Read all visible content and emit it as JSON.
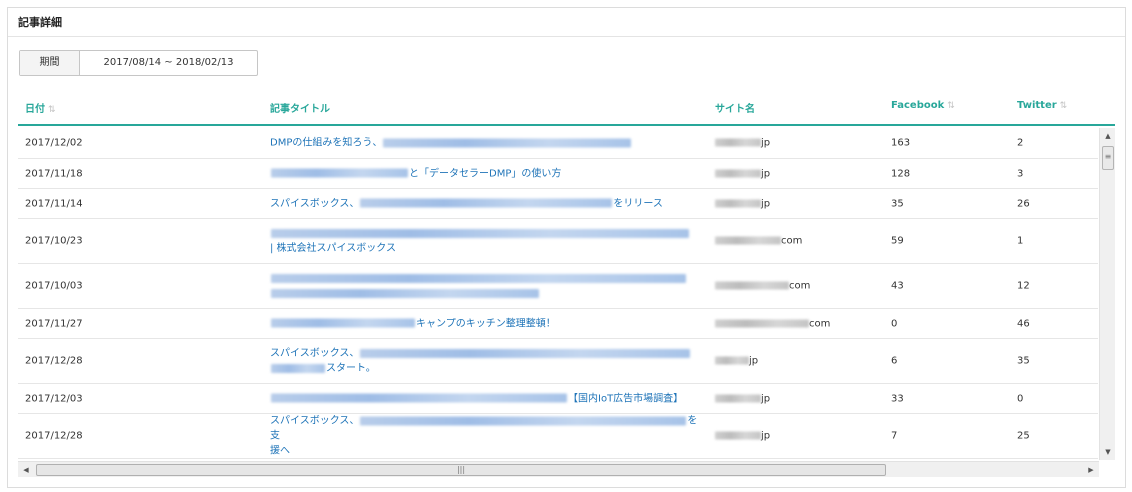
{
  "panel": {
    "title": "記事詳細"
  },
  "period": {
    "label": "期間",
    "value": "2017/08/14 ~ 2018/02/13"
  },
  "columns": {
    "date": "日付",
    "title": "記事タイトル",
    "site": "サイト名",
    "facebook": "Facebook",
    "twitter": "Twitter"
  },
  "rows": [
    {
      "date": "2017/12/02",
      "title_pre": "DMPの仕組みを知ろう、",
      "title_post": "",
      "title_line2": "",
      "site": "jp",
      "facebook": "163",
      "twitter": "2"
    },
    {
      "date": "2017/11/18",
      "title_pre": "",
      "title_post": "と「データセラーDMP」の使い方",
      "title_line2": "",
      "site": "jp",
      "facebook": "128",
      "twitter": "3"
    },
    {
      "date": "2017/11/14",
      "title_pre": "スパイスボックス、",
      "title_post": "をリリース",
      "title_line2": "",
      "site": "jp",
      "facebook": "35",
      "twitter": "26"
    },
    {
      "date": "2017/10/23",
      "title_pre": "",
      "title_post": "",
      "title_line2": "| 株式会社スパイスボックス",
      "site": "com",
      "facebook": "59",
      "twitter": "1"
    },
    {
      "date": "2017/10/03",
      "title_pre": "",
      "title_post": "",
      "title_line2": "",
      "site": "com",
      "facebook": "43",
      "twitter": "12"
    },
    {
      "date": "2017/11/27",
      "title_pre": "",
      "title_post": "キャンプのキッチン整理整頓！",
      "title_line2": "",
      "site": "com",
      "facebook": "0",
      "twitter": "46"
    },
    {
      "date": "2017/12/28",
      "title_pre": "スパイスボックス、",
      "title_post": "",
      "title_line2": "スタート。",
      "site": "jp",
      "facebook": "6",
      "twitter": "35"
    },
    {
      "date": "2017/12/03",
      "title_pre": "",
      "title_post": "【国内IoT広告市場調査】",
      "title_line2": "",
      "site": "jp",
      "facebook": "33",
      "twitter": "0"
    },
    {
      "date": "2017/12/28",
      "title_pre": "スパイスボックス、",
      "title_post": "を支",
      "title_line2": "援へ",
      "site": "jp",
      "facebook": "7",
      "twitter": "25"
    }
  ],
  "colors": {
    "accent": "#28a79a",
    "link": "#1f74b8"
  },
  "icons": {
    "sort": "sort-icon",
    "scroll_up": "arrow-up-icon",
    "scroll_down": "arrow-down-icon",
    "scroll_left": "arrow-left-icon",
    "scroll_right": "arrow-right-icon"
  }
}
